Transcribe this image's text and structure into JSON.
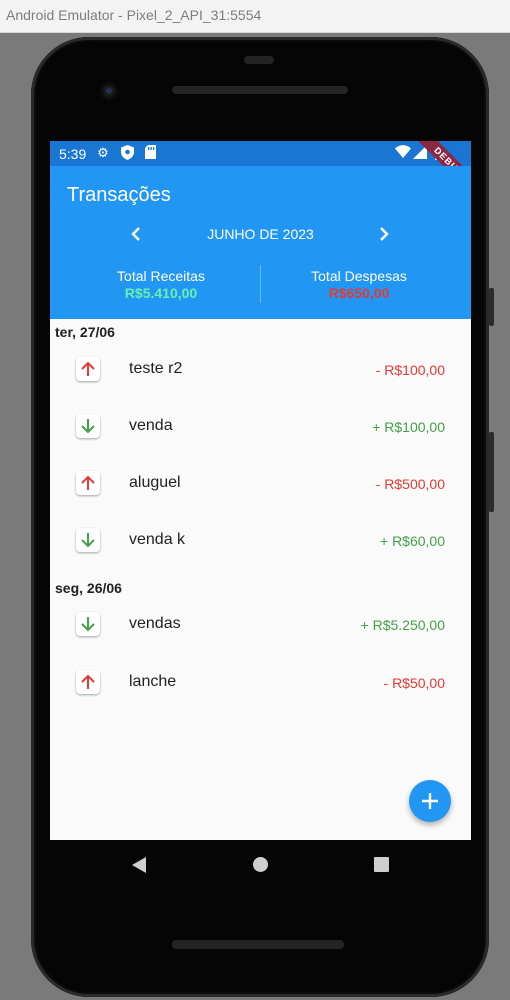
{
  "window": {
    "title": "Android Emulator - Pixel_2_API_31:5554"
  },
  "statusbar": {
    "time": "5:39",
    "debug_label": "DEBUG"
  },
  "appbar": {
    "title": "Transações",
    "month": "JUNHO DE 2023",
    "prev_icon": "chevron-left-icon",
    "next_icon": "chevron-right-icon"
  },
  "totals": {
    "income_label": "Total Receitas",
    "income_value": "R$5.410,00",
    "expense_label": "Total Despesas",
    "expense_value": "R$650,00"
  },
  "colors": {
    "appbar": "#2196f3",
    "statusbar": "#1976d2",
    "income": "#43a047",
    "income_total": "#69f0ae",
    "expense": "#e53935",
    "expense_total": "#e53935"
  },
  "groups": [
    {
      "date": "ter, 27/06",
      "items": [
        {
          "type": "expense",
          "description": "teste r2",
          "amount": "- R$100,00"
        },
        {
          "type": "income",
          "description": "venda",
          "amount": "+ R$100,00"
        },
        {
          "type": "expense",
          "description": "aluguel",
          "amount": "- R$500,00"
        },
        {
          "type": "income",
          "description": "venda k",
          "amount": "+ R$60,00"
        }
      ]
    },
    {
      "date": "seg, 26/06",
      "items": [
        {
          "type": "income",
          "description": "vendas",
          "amount": "+ R$5.250,00"
        },
        {
          "type": "expense",
          "description": "lanche",
          "amount": "- R$50,00"
        }
      ]
    }
  ],
  "fab": {
    "icon": "plus-icon"
  }
}
